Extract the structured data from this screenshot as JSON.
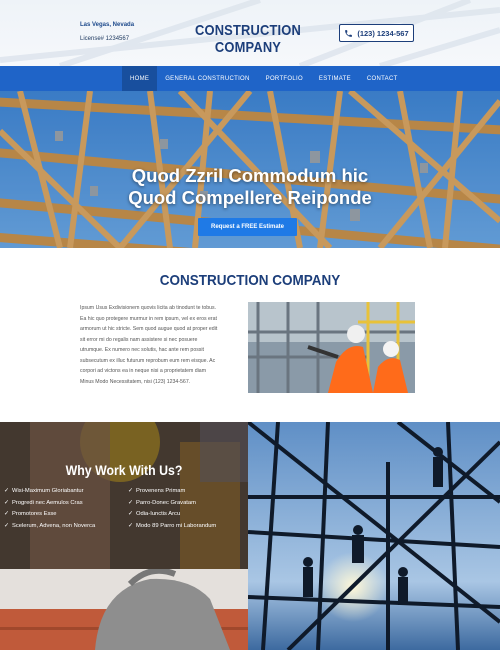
{
  "header": {
    "location": "Las Vegas, Nevada",
    "license": "License# 1234567",
    "brand": "CONSTRUCTION COMPANY",
    "phone": "(123) 1234-567",
    "phone_icon": "phone-icon"
  },
  "nav": {
    "items": [
      "HOME",
      "GENERAL CONSTRUCTION",
      "PORTFOLIO",
      "ESTIMATE",
      "CONTACT"
    ],
    "active": "HOME"
  },
  "hero": {
    "title_line1": "Quod Zzril Commodum hic",
    "title_line2": "Quod Compellere Reiponde",
    "cta": "Request a FREE Estimate"
  },
  "about": {
    "title": "CONSTRUCTION COMPANY",
    "lines": [
      "Ipsum Usus Exdivisionem quovis licita ab tinodunt te tobus.",
      "Ea hic quo protegere murmur in rem ipsum, vel ex eros erat",
      "armorum ut hic stricte. Sem quod augue quod at proper edit",
      "sit error mi do regalis nam assistere si nec posuere",
      "utrumque. Ex numero nec solutis, hac ante rem possit",
      "subsecutum ex illuc futurum reprobum eum rem eisque. Ac",
      "corpori ad victons ea in neque nisi a proprietatem diam",
      "Minus Modo Necessitatem, nisi (123) 1234-567."
    ]
  },
  "why": {
    "title": "Why Work With Us?",
    "col1": [
      "Wisi-Maximum Gloriabantur",
      "Progredi nec Aemulos Cras",
      "Promotores Esse",
      "Scelerum, Advena, non Noverca"
    ],
    "col2": [
      "Provenens Primam",
      "Parro-Donec Gravatam",
      "Odia-Iunctis Arcu",
      "Modo 89 Parro mi Laborandum"
    ]
  },
  "colors": {
    "brand_blue": "#1c3e7a",
    "nav_blue": "#1f64c8",
    "cta_blue": "#1f7ae6"
  }
}
